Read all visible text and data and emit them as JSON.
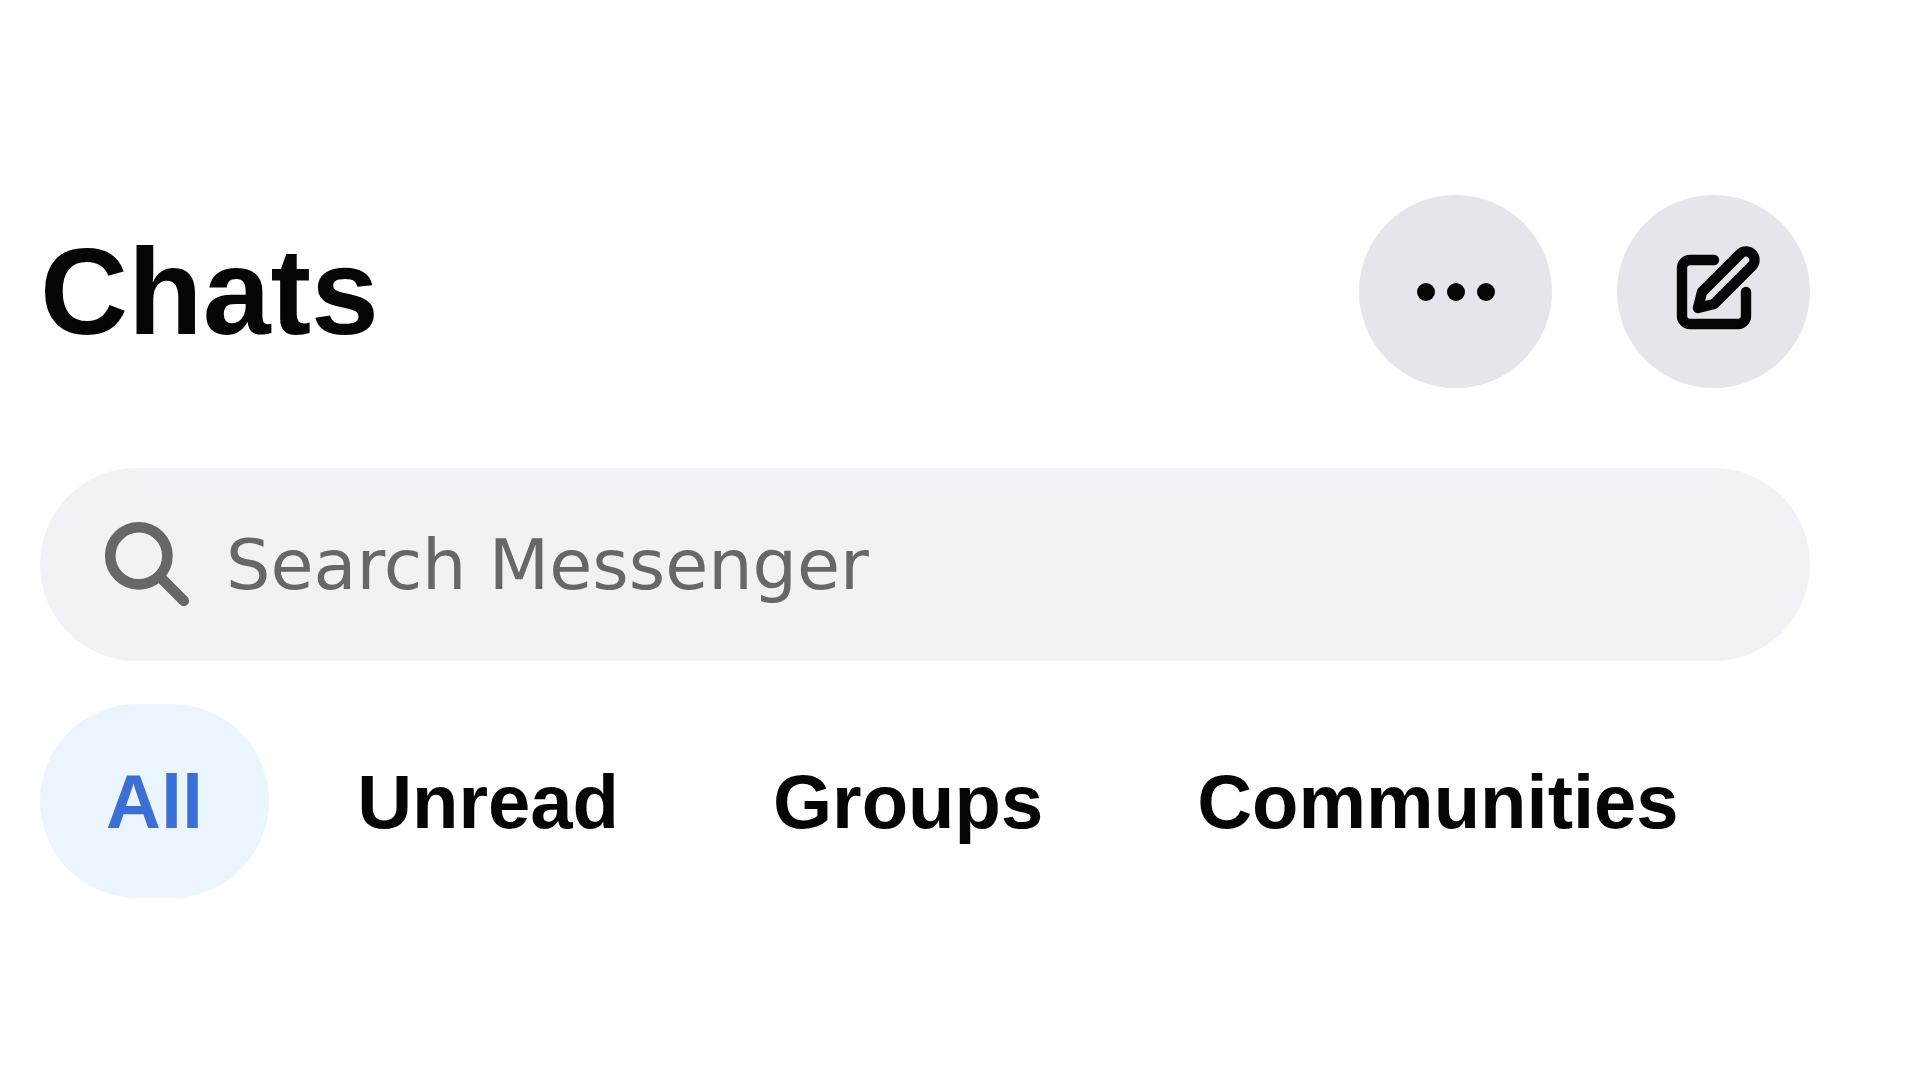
{
  "header": {
    "title": "Chats"
  },
  "search": {
    "placeholder": "Search Messenger"
  },
  "tabs": [
    {
      "label": "All",
      "selected": true
    },
    {
      "label": "Unread",
      "selected": false
    },
    {
      "label": "Groups",
      "selected": false
    },
    {
      "label": "Communities",
      "selected": false
    }
  ]
}
